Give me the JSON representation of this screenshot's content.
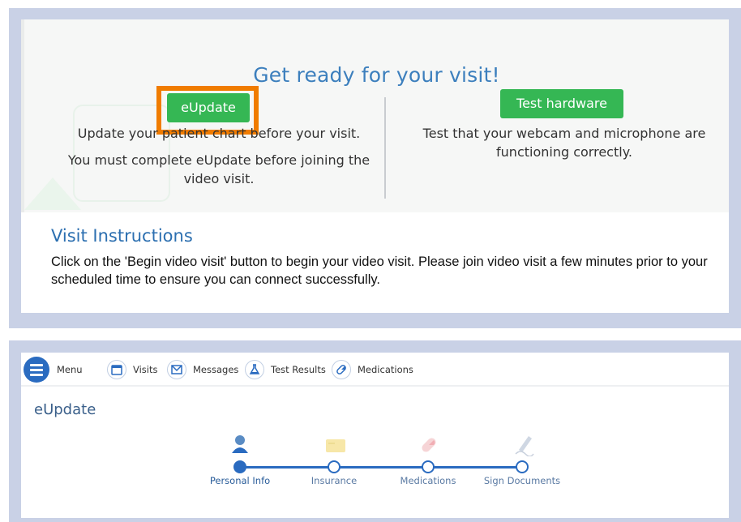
{
  "ready": {
    "title": "Get ready for your visit!",
    "eupdate_button": "eUpdate",
    "test_hardware_button": "Test hardware",
    "eupdate_text_1": "Update your patient chart before your visit.",
    "eupdate_text_2": "You must complete eUpdate before joining the video visit.",
    "hardware_text": "Test that your webcam and microphone are functioning correctly.",
    "highlight_color": "#f07c00",
    "button_color": "#35b754"
  },
  "instructions": {
    "title": "Visit Instructions",
    "body": "Click on the 'Begin video visit' button to begin your video visit. Please join video visit a few minutes prior to your scheduled time to ensure you can connect successfully."
  },
  "nav": {
    "menu_label": "Menu",
    "items": [
      {
        "label": "Visits",
        "icon": "calendar-icon"
      },
      {
        "label": "Messages",
        "icon": "envelope-icon"
      },
      {
        "label": "Test Results",
        "icon": "flask-icon"
      },
      {
        "label": "Medications",
        "icon": "pill-icon"
      }
    ]
  },
  "eupdate": {
    "heading": "eUpdate",
    "steps": [
      {
        "label": "Personal Info",
        "icon": "person-icon",
        "active": true
      },
      {
        "label": "Insurance",
        "icon": "card-icon",
        "active": false
      },
      {
        "label": "Medications",
        "icon": "pill-icon",
        "active": false
      },
      {
        "label": "Sign Documents",
        "icon": "pen-icon",
        "active": false
      }
    ]
  }
}
